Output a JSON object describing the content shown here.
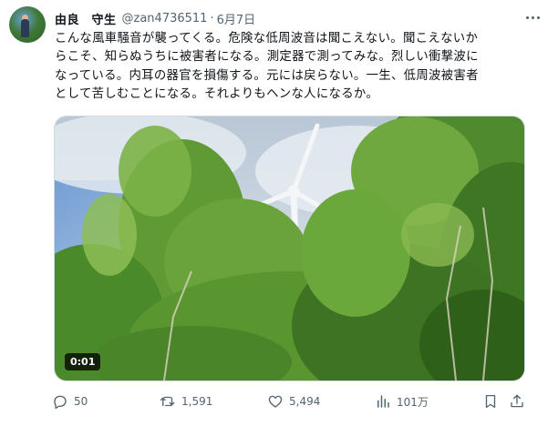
{
  "author": {
    "name": "由良　守生",
    "handle": "@zan4736511",
    "separator": "·",
    "date": "6月7日"
  },
  "tweet": {
    "lines": [
      "こんな風車騒音が襲ってくる。危険な低周波音は聞こえない。聞こえないか",
      "らこそ、知らぬうちに被害者になる。測定器で測ってみな。烈しい衝撃波に",
      "なっている。内耳の器官を損傷する。元には戻らない。一生、低周波被害者",
      "として苦しむことになる。それよりもヘンな人になるか。"
    ]
  },
  "media": {
    "video_time": "0:01",
    "scene": "wind-turbine-behind-trees"
  },
  "actions": {
    "reply_count": "50",
    "retweet_count": "1,591",
    "like_count": "5,494",
    "view_count": "101万"
  },
  "colors": {
    "text": "#0f1419",
    "muted": "#536471",
    "border": "#cfd9de"
  },
  "icons": [
    "more-icon",
    "reply-icon",
    "retweet-icon",
    "like-icon",
    "views-icon",
    "bookmark-icon",
    "share-icon"
  ]
}
